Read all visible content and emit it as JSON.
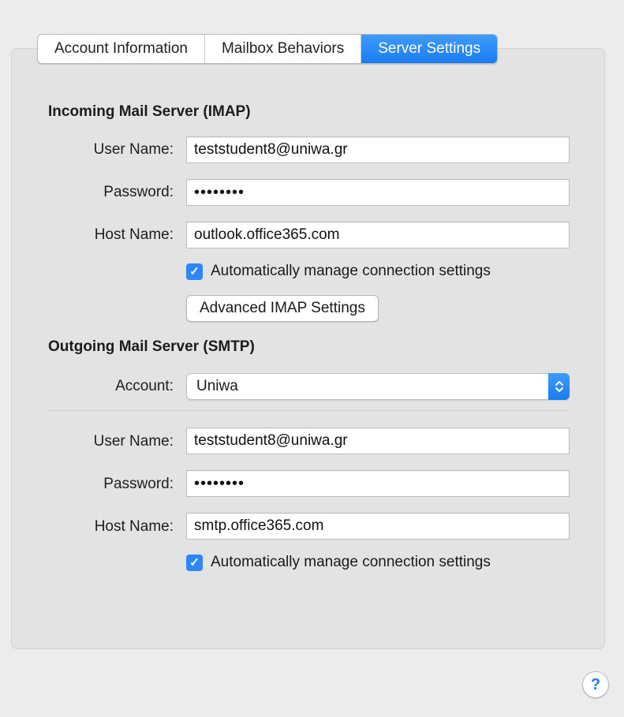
{
  "tabs": [
    {
      "label": "Account Information",
      "active": false
    },
    {
      "label": "Mailbox Behaviors",
      "active": false
    },
    {
      "label": "Server Settings",
      "active": true
    }
  ],
  "incoming": {
    "title": "Incoming Mail Server (IMAP)",
    "username_label": "User Name:",
    "username_value": "teststudent8@uniwa.gr",
    "password_label": "Password:",
    "password_value": "••••••••",
    "host_label": "Host Name:",
    "host_value": "outlook.office365.com",
    "auto_manage_label": "Automatically manage connection settings",
    "auto_manage_checked": true,
    "advanced_button": "Advanced IMAP Settings"
  },
  "outgoing": {
    "title": "Outgoing Mail Server (SMTP)",
    "account_label": "Account:",
    "account_value": "Uniwa",
    "username_label": "User Name:",
    "username_value": "teststudent8@uniwa.gr",
    "password_label": "Password:",
    "password_value": "••••••••",
    "host_label": "Host Name:",
    "host_value": "smtp.office365.com",
    "auto_manage_label": "Automatically manage connection settings",
    "auto_manage_checked": true
  },
  "help": {
    "glyph": "?"
  },
  "colors": {
    "accent": "#1a7cf5",
    "panel": "#e3e3e3",
    "window": "#ececec"
  },
  "icons": {
    "checkbox": "checkmark-icon",
    "select": "up-down-chevron-icon",
    "help": "help-icon"
  }
}
